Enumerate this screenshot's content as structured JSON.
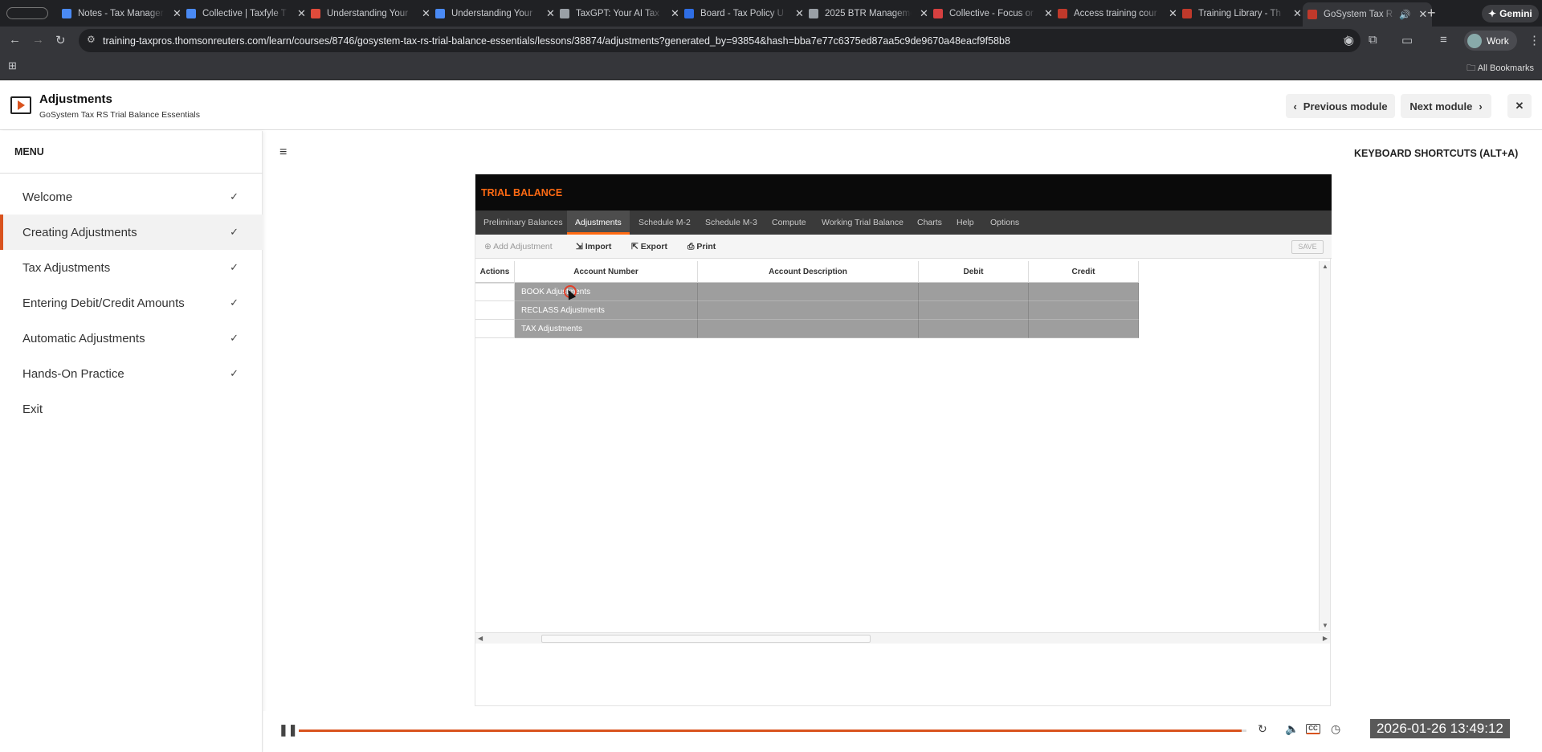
{
  "browser": {
    "tabs": [
      {
        "title": "Notes - Tax Manager",
        "color": "#4a8af4"
      },
      {
        "title": "Collective | Taxfyle T",
        "color": "#4a8af4"
      },
      {
        "title": "Understanding Your",
        "color": "#e04b3b"
      },
      {
        "title": "Understanding Your",
        "color": "#4a8af4"
      },
      {
        "title": "TaxGPT: Your AI Tax",
        "color": "#9aa0a6"
      },
      {
        "title": "Board - Tax Policy U",
        "color": "#2f6ee5"
      },
      {
        "title": "2025 BTR Manageme",
        "color": "#9aa0a6"
      },
      {
        "title": "Collective - Focus or",
        "color": "#d64040"
      },
      {
        "title": "Access training cour",
        "color": "#c0392b"
      },
      {
        "title": "Training Library - Th",
        "color": "#c0392b"
      },
      {
        "title": "GoSystem Tax R",
        "color": "#c0392b"
      }
    ],
    "gemini_label": "Gemini",
    "url": "training-taxpros.thomsonreuters.com/learn/courses/8746/gosystem-tax-rs-trial-balance-essentials/lessons/38874/adjustments?generated_by=93854&hash=bba7e77c6375ed87aa5c9de9670a48eacf9f58b8",
    "profile_label": "Work",
    "bookmarks_label": "All Bookmarks"
  },
  "lesson": {
    "title": "Adjustments",
    "subtitle": "GoSystem Tax RS Trial Balance Essentials",
    "prev_label": "Previous module",
    "next_label": "Next module"
  },
  "menu": {
    "heading": "MENU",
    "items": [
      {
        "label": "Welcome",
        "done": "✓"
      },
      {
        "label": "Creating Adjustments",
        "done": "✓"
      },
      {
        "label": "Tax Adjustments",
        "done": "✓"
      },
      {
        "label": "Entering Debit/Credit Amounts",
        "done": "✓"
      },
      {
        "label": "Automatic Adjustments",
        "done": "✓"
      },
      {
        "label": "Hands-On Practice",
        "done": "✓"
      },
      {
        "label": "Exit",
        "done": ""
      }
    ]
  },
  "keyboard_shortcuts": "KEYBOARD SHORTCUTS (ALT+A)",
  "app": {
    "header": "TRIAL BALANCE",
    "tabs": [
      "Preliminary Balances",
      "Adjustments",
      "Schedule M-2",
      "Schedule M-3",
      "Compute",
      "Working Trial Balance",
      "Charts",
      "Help",
      "Options"
    ],
    "actions": {
      "add": "Add Adjustment",
      "import": "Import",
      "export": "Export",
      "print": "Print",
      "save": "SAVE"
    },
    "columns": [
      "Actions",
      "Account Number",
      "Account Description",
      "Debit",
      "Credit"
    ],
    "rows": [
      "BOOK Adjustments",
      "RECLASS Adjustments",
      "TAX Adjustments"
    ]
  },
  "video": {
    "progress": 0.995,
    "timestamp": "2026-01-26 13:49:12",
    "accent": "#d9531e"
  }
}
